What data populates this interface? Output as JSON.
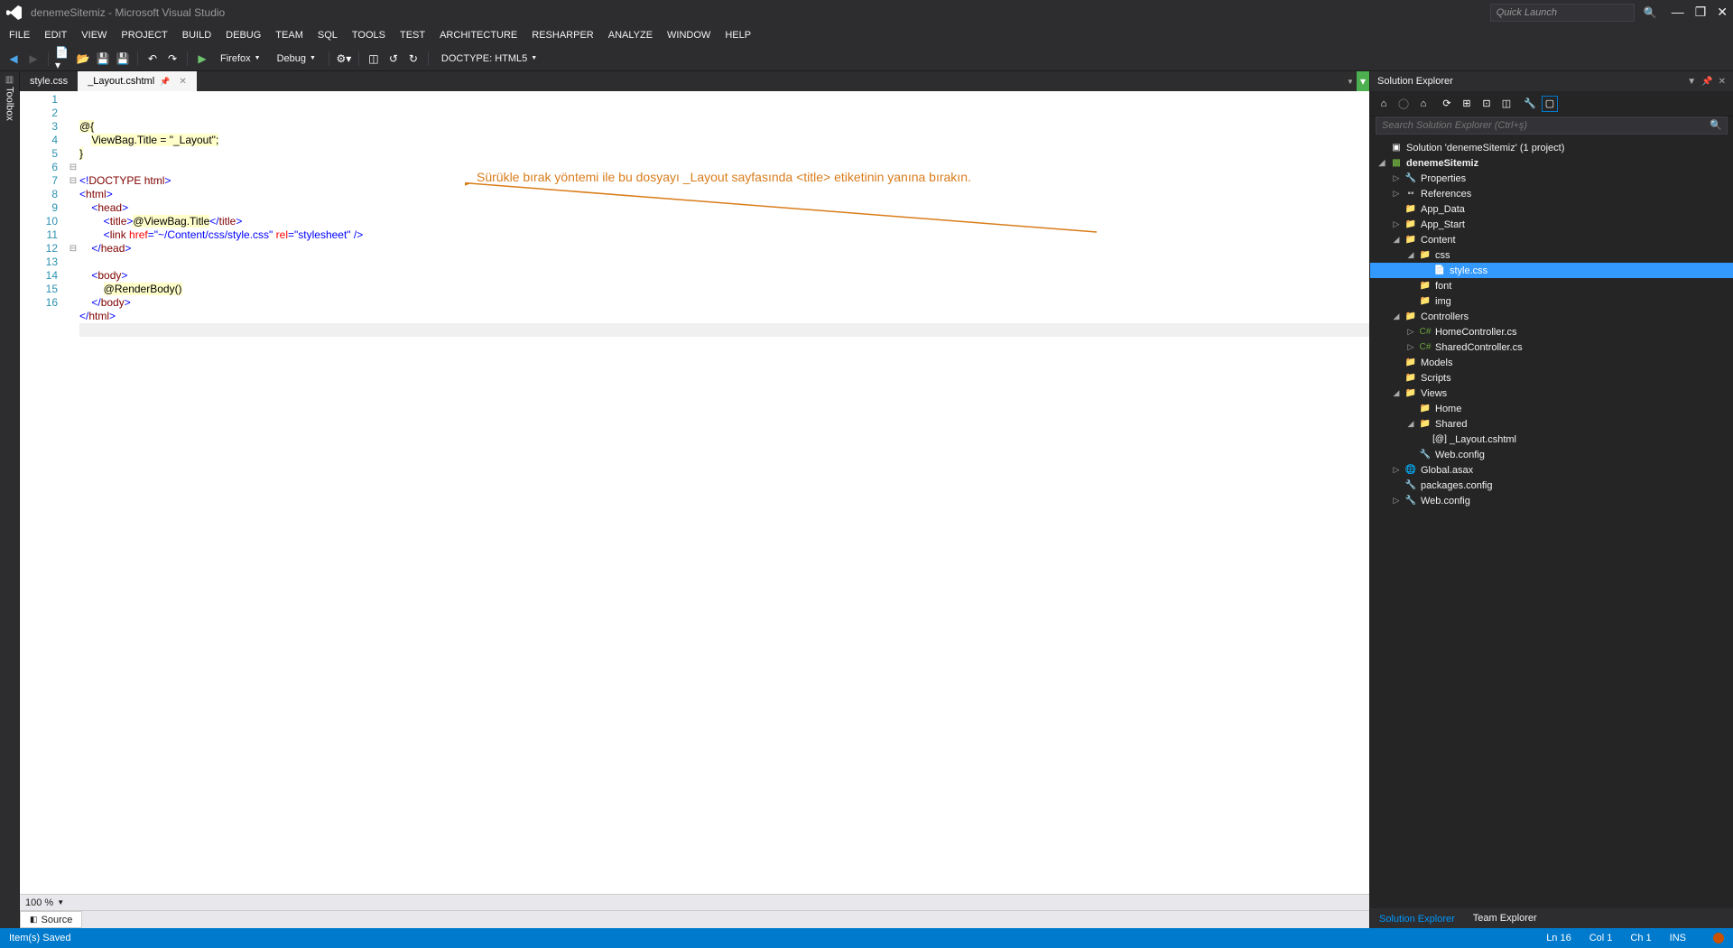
{
  "window": {
    "title": "denemeSitemiz - Microsoft Visual Studio",
    "quick_launch_placeholder": "Quick Launch"
  },
  "menu": [
    "FILE",
    "EDIT",
    "VIEW",
    "PROJECT",
    "BUILD",
    "DEBUG",
    "TEAM",
    "SQL",
    "TOOLS",
    "TEST",
    "ARCHITECTURE",
    "RESHARPER",
    "ANALYZE",
    "WINDOW",
    "HELP"
  ],
  "toolbar": {
    "browser": "Firefox",
    "config": "Debug",
    "doctype": "DOCTYPE: HTML5"
  },
  "tabs": [
    {
      "name": "style.css",
      "active": false
    },
    {
      "name": "_Layout.cshtml",
      "active": true,
      "pinned": true
    }
  ],
  "code_lines": [
    {
      "n": 1,
      "fold": "",
      "content": [
        {
          "cls": "k-razor-bg",
          "t": "@{"
        }
      ]
    },
    {
      "n": 2,
      "fold": "",
      "content": [
        {
          "cls": "",
          "t": "    "
        },
        {
          "cls": "k-razor-bg",
          "t": "ViewBag.Title = \"_Layout\";"
        }
      ]
    },
    {
      "n": 3,
      "fold": "",
      "content": [
        {
          "cls": "k-razor-bg",
          "t": "}"
        }
      ]
    },
    {
      "n": 4,
      "fold": "",
      "content": []
    },
    {
      "n": 5,
      "fold": "",
      "content": [
        {
          "cls": "k-str",
          "t": "<!"
        },
        {
          "cls": "k-tag",
          "t": "DOCTYPE"
        },
        {
          "cls": "",
          "t": " "
        },
        {
          "cls": "k-tag",
          "t": "html"
        },
        {
          "cls": "k-str",
          "t": ">"
        }
      ]
    },
    {
      "n": 6,
      "fold": "⊟",
      "content": [
        {
          "cls": "k-str",
          "t": "<"
        },
        {
          "cls": "k-tag",
          "t": "html"
        },
        {
          "cls": "k-str",
          "t": ">"
        }
      ]
    },
    {
      "n": 7,
      "fold": "⊟",
      "content": [
        {
          "cls": "",
          "t": "    "
        },
        {
          "cls": "k-str",
          "t": "<"
        },
        {
          "cls": "k-tag",
          "t": "head"
        },
        {
          "cls": "k-str",
          "t": ">"
        }
      ]
    },
    {
      "n": 8,
      "fold": "",
      "content": [
        {
          "cls": "",
          "t": "        "
        },
        {
          "cls": "k-str",
          "t": "<"
        },
        {
          "cls": "k-tag",
          "t": "title"
        },
        {
          "cls": "k-str",
          "t": ">"
        },
        {
          "cls": "k-razor-bg",
          "t": "@ViewBag.Title"
        },
        {
          "cls": "k-str",
          "t": "</"
        },
        {
          "cls": "k-tag",
          "t": "title"
        },
        {
          "cls": "k-str",
          "t": ">"
        }
      ]
    },
    {
      "n": 9,
      "fold": "",
      "content": [
        {
          "cls": "",
          "t": "        "
        },
        {
          "cls": "k-str",
          "t": "<"
        },
        {
          "cls": "k-tag",
          "t": "link"
        },
        {
          "cls": "",
          "t": " "
        },
        {
          "cls": "k-attr",
          "t": "href"
        },
        {
          "cls": "k-str",
          "t": "=\"~/Content/css/style.css\""
        },
        {
          "cls": "",
          "t": " "
        },
        {
          "cls": "k-attr",
          "t": "rel"
        },
        {
          "cls": "k-str",
          "t": "=\"stylesheet\""
        },
        {
          "cls": "",
          "t": " "
        },
        {
          "cls": "k-str",
          "t": "/>"
        }
      ]
    },
    {
      "n": 10,
      "fold": "",
      "content": [
        {
          "cls": "",
          "t": "    "
        },
        {
          "cls": "k-str",
          "t": "</"
        },
        {
          "cls": "k-tag",
          "t": "head"
        },
        {
          "cls": "k-str",
          "t": ">"
        }
      ]
    },
    {
      "n": 11,
      "fold": "",
      "content": []
    },
    {
      "n": 12,
      "fold": "⊟",
      "content": [
        {
          "cls": "",
          "t": "    "
        },
        {
          "cls": "k-str",
          "t": "<"
        },
        {
          "cls": "k-tag",
          "t": "body"
        },
        {
          "cls": "k-str",
          "t": ">"
        }
      ]
    },
    {
      "n": 13,
      "fold": "",
      "content": [
        {
          "cls": "",
          "t": "        "
        },
        {
          "cls": "k-razor-bg",
          "t": "@RenderBody()"
        }
      ]
    },
    {
      "n": 14,
      "fold": "",
      "content": [
        {
          "cls": "",
          "t": "    "
        },
        {
          "cls": "k-str",
          "t": "</"
        },
        {
          "cls": "k-tag",
          "t": "body"
        },
        {
          "cls": "k-str",
          "t": ">"
        }
      ]
    },
    {
      "n": 15,
      "fold": "",
      "content": [
        {
          "cls": "k-str",
          "t": "</"
        },
        {
          "cls": "k-tag",
          "t": "html"
        },
        {
          "cls": "k-str",
          "t": ">"
        }
      ]
    },
    {
      "n": 16,
      "fold": "",
      "hl": true,
      "content": []
    }
  ],
  "annotation": "Sürükle bırak yöntemi ile bu dosyayı _Layout sayfasında <title> etiketinin yanına bırakın.",
  "editor_status": {
    "zoom": "100 %",
    "source_tab": "Source"
  },
  "solution_explorer": {
    "title": "Solution Explorer",
    "search_placeholder": "Search Solution Explorer (Ctrl+ş)",
    "tree": [
      {
        "indent": 0,
        "arrow": "",
        "icon": "sln",
        "label": "Solution 'denemeSitemiz' (1 project)"
      },
      {
        "indent": 0,
        "arrow": "◢",
        "icon": "proj",
        "label": "denemeSitemiz",
        "bold": true
      },
      {
        "indent": 1,
        "arrow": "▷",
        "icon": "wrench",
        "label": "Properties"
      },
      {
        "indent": 1,
        "arrow": "▷",
        "icon": "ref",
        "label": "References"
      },
      {
        "indent": 1,
        "arrow": "",
        "icon": "folder",
        "label": "App_Data"
      },
      {
        "indent": 1,
        "arrow": "▷",
        "icon": "folder",
        "label": "App_Start"
      },
      {
        "indent": 1,
        "arrow": "◢",
        "icon": "folder",
        "label": "Content"
      },
      {
        "indent": 2,
        "arrow": "◢",
        "icon": "folder",
        "label": "css"
      },
      {
        "indent": 3,
        "arrow": "",
        "icon": "file",
        "label": "style.css",
        "selected": true
      },
      {
        "indent": 2,
        "arrow": "",
        "icon": "folder",
        "label": "font"
      },
      {
        "indent": 2,
        "arrow": "",
        "icon": "folder",
        "label": "img"
      },
      {
        "indent": 1,
        "arrow": "◢",
        "icon": "folder",
        "label": "Controllers"
      },
      {
        "indent": 2,
        "arrow": "▷",
        "icon": "cs",
        "label": "HomeController.cs"
      },
      {
        "indent": 2,
        "arrow": "▷",
        "icon": "cs",
        "label": "SharedController.cs"
      },
      {
        "indent": 1,
        "arrow": "",
        "icon": "folder",
        "label": "Models"
      },
      {
        "indent": 1,
        "arrow": "",
        "icon": "folder",
        "label": "Scripts"
      },
      {
        "indent": 1,
        "arrow": "◢",
        "icon": "folder",
        "label": "Views"
      },
      {
        "indent": 2,
        "arrow": "",
        "icon": "folder",
        "label": "Home"
      },
      {
        "indent": 2,
        "arrow": "◢",
        "icon": "folder",
        "label": "Shared"
      },
      {
        "indent": 3,
        "arrow": "",
        "icon": "cshtml",
        "label": "_Layout.cshtml"
      },
      {
        "indent": 2,
        "arrow": "",
        "icon": "cfg",
        "label": "Web.config"
      },
      {
        "indent": 1,
        "arrow": "▷",
        "icon": "asax",
        "label": "Global.asax"
      },
      {
        "indent": 1,
        "arrow": "",
        "icon": "cfg",
        "label": "packages.config"
      },
      {
        "indent": 1,
        "arrow": "▷",
        "icon": "cfg",
        "label": "Web.config"
      }
    ]
  },
  "panel_tabs": [
    "Solution Explorer",
    "Team Explorer"
  ],
  "status": {
    "left": "Item(s) Saved",
    "ln": "Ln 16",
    "col": "Col 1",
    "ch": "Ch 1",
    "ins": "INS"
  },
  "sidetool": "Toolbox"
}
